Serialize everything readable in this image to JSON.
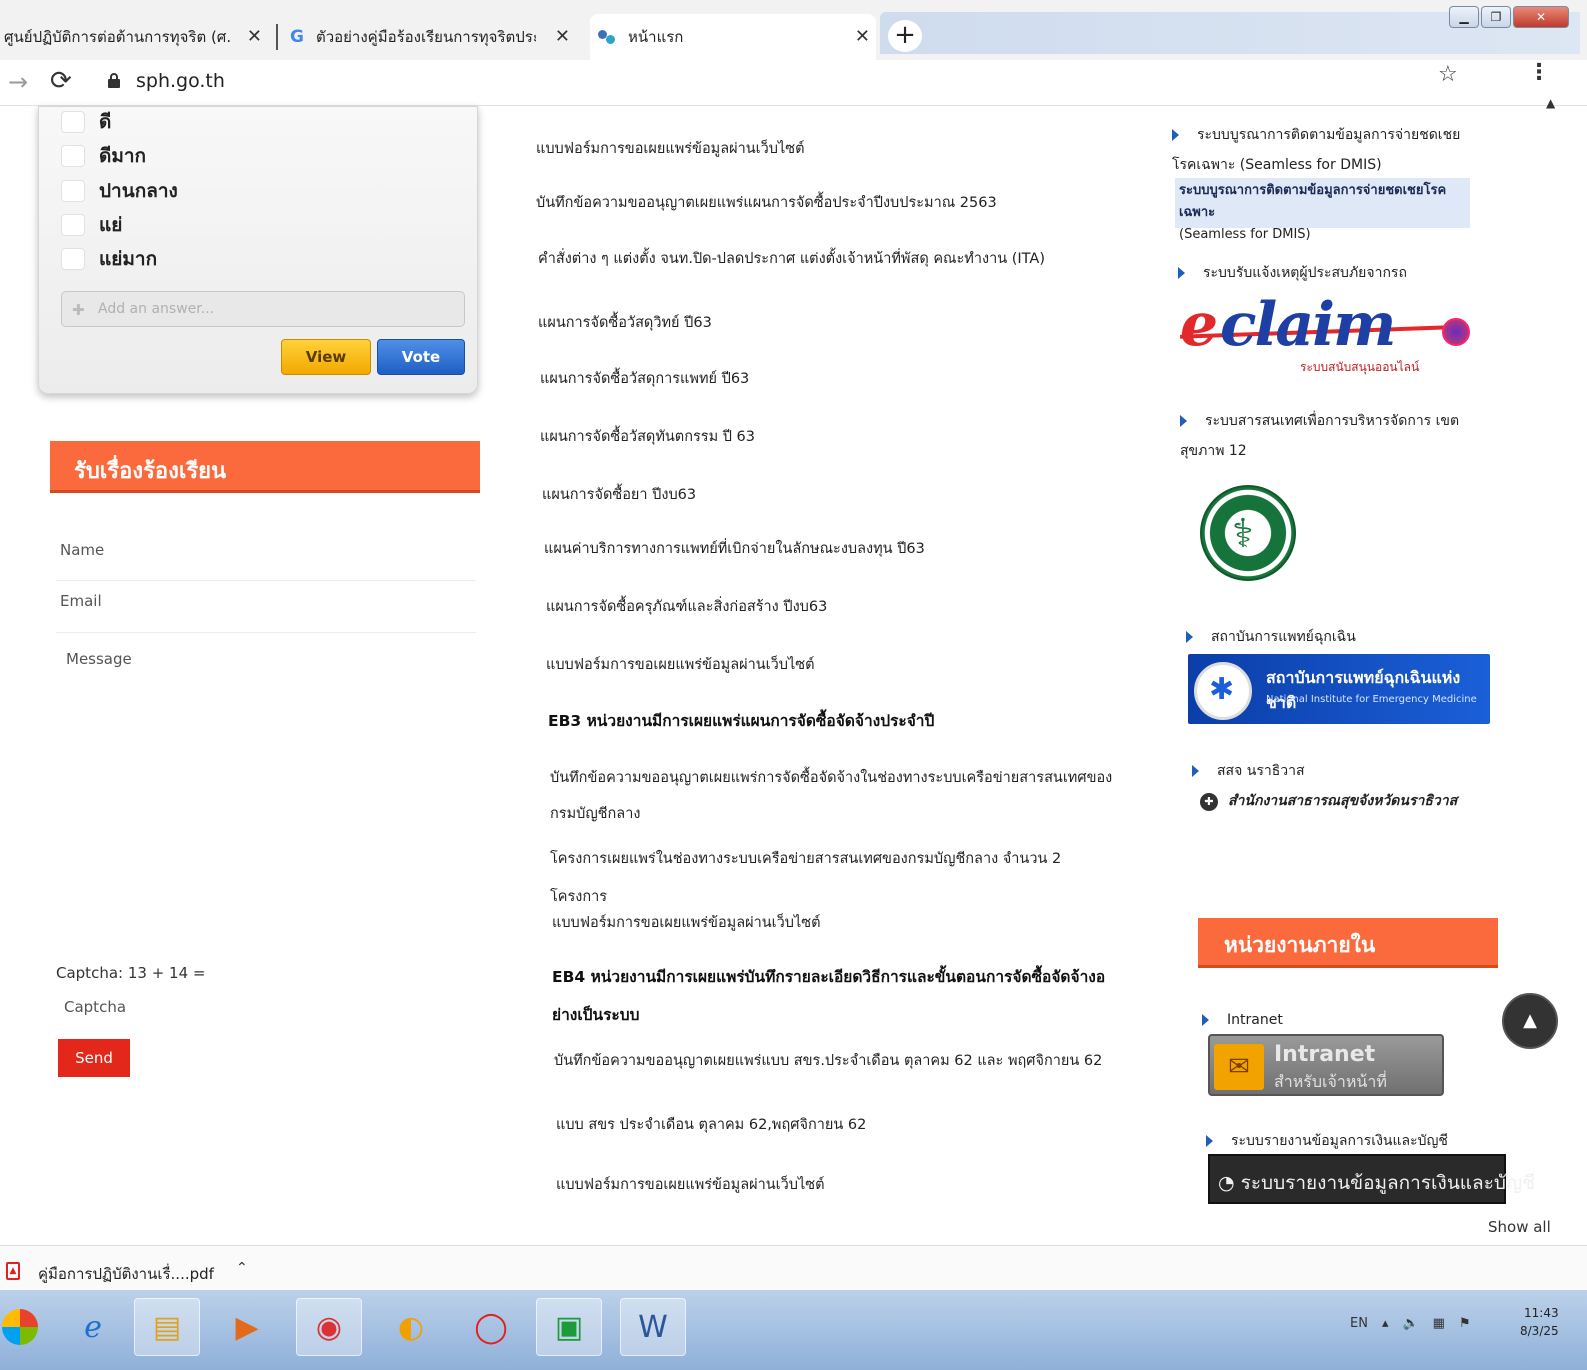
{
  "browser": {
    "tabs": [
      {
        "title": "ศูนย์ปฏิบัติการต่อต้านการทุจริต (ศ.",
        "close": "✕"
      },
      {
        "icon": "G",
        "title": "ตัวอย่างคู่มือร้องเรียนการทุจริตประ",
        "close": "✕"
      },
      {
        "title": "หน้าแรก",
        "close": "✕"
      }
    ],
    "new_tab": "+",
    "url": "sph.go.th"
  },
  "poll": {
    "options": [
      "ดี",
      "ดีมาก",
      "ปานกลาง",
      "แย่",
      "แย่มาก"
    ],
    "add_answer_placeholder": "Add an answer...",
    "view_label": "View",
    "vote_label": "Vote"
  },
  "complaint_form": {
    "heading": "รับเรื่องร้องเรียน",
    "name_label": "Name",
    "email_label": "Email",
    "message_label": "Message",
    "captcha_label": "Captcha: 13 + 14 =",
    "captcha_placeholder": "Captcha",
    "send_label": "Send"
  },
  "documents": [
    {
      "text": "แบบฟอร์มการขอเผยแพร่ข้อมูลผ่านเว็บไซต์",
      "bold": false
    },
    {
      "text": "บันทึกข้อความขออนุญาตเผยแพร่แผนการจัดซื้อประจำปีงบประมาณ 2563",
      "bold": false
    },
    {
      "text": "คำสั่งต่าง ๆ แต่งตั้ง จนท.ปิด-ปลดประกาศ แต่งตั้งเจ้าหน้าที่พัสดุ คณะทำงาน (ITA)",
      "bold": false
    },
    {
      "text": "แผนการจัดซื้อวัสดุวิทย์ ปี63",
      "bold": false
    },
    {
      "text": "แผนการจัดซื้อวัสดุการแพทย์ ปี63",
      "bold": false
    },
    {
      "text": "แผนการจัดซื้อวัสดุทันตกรรม ปี 63",
      "bold": false
    },
    {
      "text": "แผนการจัดซื้อยา ปีงบ63",
      "bold": false
    },
    {
      "text": "แผนค่าบริการทางการแพทย์ที่เบิกจ่ายในลักษณะงบลงทุน ปี63",
      "bold": false
    },
    {
      "text": "แผนการจัดซื้อครุภัณฑ์และสิ่งก่อสร้าง ปีงบ63",
      "bold": false
    },
    {
      "text": "แบบฟอร์มการขอเผยแพร่ข้อมูลผ่านเว็บไซต์",
      "bold": false
    },
    {
      "text": "EB3 หน่วยงานมีการเผยแพร่แผนการจัดซื้อจัดจ้างประจำปี",
      "bold": true
    },
    {
      "text": "บันทึกข้อความขออนุญาตเผยแพร่การจัดซื้อจัดจ้างในช่องทางระบบเครือข่ายสารสนเทศของกรมบัญชีกลาง",
      "bold": false
    },
    {
      "text": "โครงการเผยแพร่ในช่องทางระบบเครือข่ายสารสนเทศของกรมบัญชีกลาง จำนวน 2 โครงการ",
      "bold": false
    },
    {
      "text": "แบบฟอร์มการขอเผยแพร่ข้อมูลผ่านเว็บไซต์",
      "bold": false
    },
    {
      "text": "EB4 หน่วยงานมีการเผยแพร่บันทึกรายละเอียดวิธีการและขั้นตอนการจัดซื้อจัดจ้างอย่างเป็นระบบ",
      "bold": true
    },
    {
      "text": "บันทึกข้อความขออนุญาตเผยแพร่แบบ สขร.ประจำเดือน ตุลาคม 62 และ พฤศจิกายน 62",
      "bold": false
    },
    {
      "text": "แบบ สขร ประจำเดือน ตุลาคม 62,พฤศจิกายน 62",
      "bold": false
    },
    {
      "text": "แบบฟอร์มการขอเผยแพร่ข้อมูลผ่านเว็บไซต์",
      "bold": false
    }
  ],
  "sidebar": {
    "dmis_link": "ระบบบูรณาการติดตามข้อมูลการจ่ายชดเชยโรคเฉพาะ (Seamless for DMIS)",
    "dmis_banner_title": "ระบบบูรณาการติดตามข้อมูลการจ่ายชดเชยโรคเฉพาะ",
    "dmis_banner_sub": "(Seamless for DMIS)",
    "eclaim_link": "ระบบรับแจ้งเหตุผู้ประสบภัยจากรถ",
    "eclaim_e": "e",
    "eclaim_logo": "claim",
    "eclaim_sub": "ระบบสนับสนุนออนไลน์",
    "health_link": "ระบบสารสนเทศเพื่อการบริหารจัดการ เขตสุขภาพ 12",
    "niem_link": "สถาบันการแพทย์ฉุกเฉิน",
    "niem_title": "สถาบันการแพทย์ฉุกเฉินแห่งชาติ",
    "niem_sub": "National Institute for Emergency Medicine",
    "ssj_link": "สสจ นราธิวาส",
    "ssj_logo": "สำนักงานสาธารณสุขจังหวัดนราธิวาส",
    "internal_heading": "หน่วยงานภายใน",
    "intranet_link": "Intranet",
    "intranet_title": "Intranet",
    "intranet_sub": "สำหรับเจ้าหน้าที่",
    "finance_link": "ระบบรายงานข้อมูลการเงินและบัญชี",
    "finance_banner": "ระบบรายงานข้อมูลการเงินและบัญชี"
  },
  "downloads": {
    "file_name": "คู่มือการปฏิบัติงานเรื่....pdf",
    "show_all": "Show all"
  },
  "taskbar": {
    "tray_lang": "EN",
    "clock_time": "11:43",
    "clock_date": "8/3/25"
  }
}
